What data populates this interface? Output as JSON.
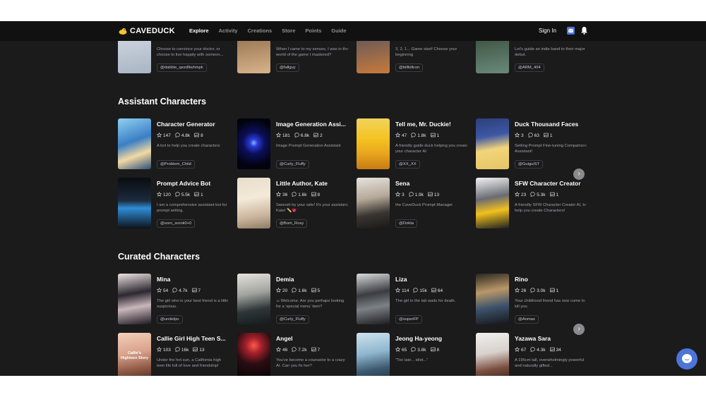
{
  "header": {
    "logo_text": "CAVEDUCK",
    "nav": [
      "Explore",
      "Activity",
      "Creations",
      "Store",
      "Points",
      "Guide"
    ],
    "active_nav": "Explore",
    "sign_in": "Sign In"
  },
  "top_row": [
    {
      "desc": "Choose to convince your doctor, or choose to live happily with someon...",
      "author": "@dabble_qezd9whmpk"
    },
    {
      "desc": "When I came to my senses, I was in the world of the game I mastered?",
      "author": "@fallguy"
    },
    {
      "desc": "3, 2, 1... Game start! Choose your beginning",
      "author": "@billbillcon"
    },
    {
      "desc": "Let's guide an indie band to their major debut.",
      "author": "@ARM_404"
    }
  ],
  "assistant_section": {
    "title": "Assistant Characters",
    "cards": [
      {
        "name": "Character Generator",
        "stars": "147",
        "chats": "4.8k",
        "images": "8",
        "desc": "A bot to help you create characters",
        "author": "@Problem_Child"
      },
      {
        "name": "Image Generation Assi...",
        "stars": "181",
        "chats": "6.8k",
        "images": "2",
        "desc": "Image Prompt Generation Assistant",
        "author": "@Curly_Fluffy"
      },
      {
        "name": "Tell me, Mr. Duckie!",
        "stars": "47",
        "chats": "1.8k",
        "images": "1",
        "desc": "A friendly guide duck helping you create your character AI",
        "author": "@XX_XX"
      },
      {
        "name": "Duck Thousand Faces",
        "stars": "3",
        "chats": "63",
        "images": "1",
        "desc": "Setting Prompt Fine-tuning Comparison Assistant!",
        "author": "@GuiguiST"
      },
      {
        "name": "Prompt Advice Bot",
        "stars": "120",
        "chats": "5.5k",
        "images": "1",
        "desc": "I am a comprehensive assistant bot for prompt writing.",
        "author": "@soro_sorok0+0"
      },
      {
        "name": "Little Author, Kate",
        "stars": "36",
        "chats": "1.6k",
        "images": "8",
        "desc": "Swoosh by your side! It's your assistant, Kate! ✏️💗",
        "author": "@Bom_Rosy"
      },
      {
        "name": "Sena",
        "stars": "3",
        "chats": "1.9k",
        "images": "13",
        "desc": "the CaveDuck Prompt Manager",
        "author": "@Dokta"
      },
      {
        "name": "SFW Character Creator",
        "stars": "23",
        "chats": "5.3k",
        "images": "1",
        "desc": "A friendly SFW Character Creator AI, to help you create Characters!",
        "author": ""
      }
    ]
  },
  "curated_section": {
    "title": "Curated Characters",
    "cards": [
      {
        "name": "Mina",
        "stars": "54",
        "chats": "4.7k",
        "images": "7",
        "desc": "The girl who is your best friend is a little suspicious.",
        "author": "@undelpo"
      },
      {
        "name": "Demia",
        "stars": "20",
        "chats": "1.6k",
        "images": "5",
        "desc": "☕ Welcome. Are you perhaps looking for a 'special menu' item?",
        "author": "@Curly_Fluffy"
      },
      {
        "name": "Liza",
        "stars": "114",
        "chats": "15k",
        "images": "64",
        "desc": "The girl in the lab waits for death.",
        "author": "@superFP"
      },
      {
        "name": "Rino",
        "stars": "26",
        "chats": "3.0k",
        "images": "1",
        "desc": "Your childhood friend has now come to kill you",
        "author": "@Anmax"
      },
      {
        "name": "Callie Girl High Teen S...",
        "stars": "103",
        "chats": "16k",
        "images": "13",
        "desc": "Under the hot sun, a California high teen life full of love and friendship!",
        "author": ""
      },
      {
        "name": "Angel",
        "stars": "46",
        "chats": "7.2k",
        "images": "7",
        "desc": "You've become a counselor to a crazy AI. Can you fix her?",
        "author": ""
      },
      {
        "name": "Jeong Ha-yeong",
        "stars": "65",
        "chats": "3.8k",
        "images": "8",
        "desc": "\"Too late... idiot...\"",
        "author": ""
      },
      {
        "name": "Yazawa Sara",
        "stars": "67",
        "chats": "4.3k",
        "images": "34",
        "desc": "A 195cm tall, overwhelmingly powerful and naturally gifted...",
        "author": ""
      }
    ]
  },
  "thumb_text": {
    "callie": "Callie's Highteen Story"
  },
  "colors": {
    "background": "#1b1b1c",
    "accent": "#4d74d8"
  }
}
